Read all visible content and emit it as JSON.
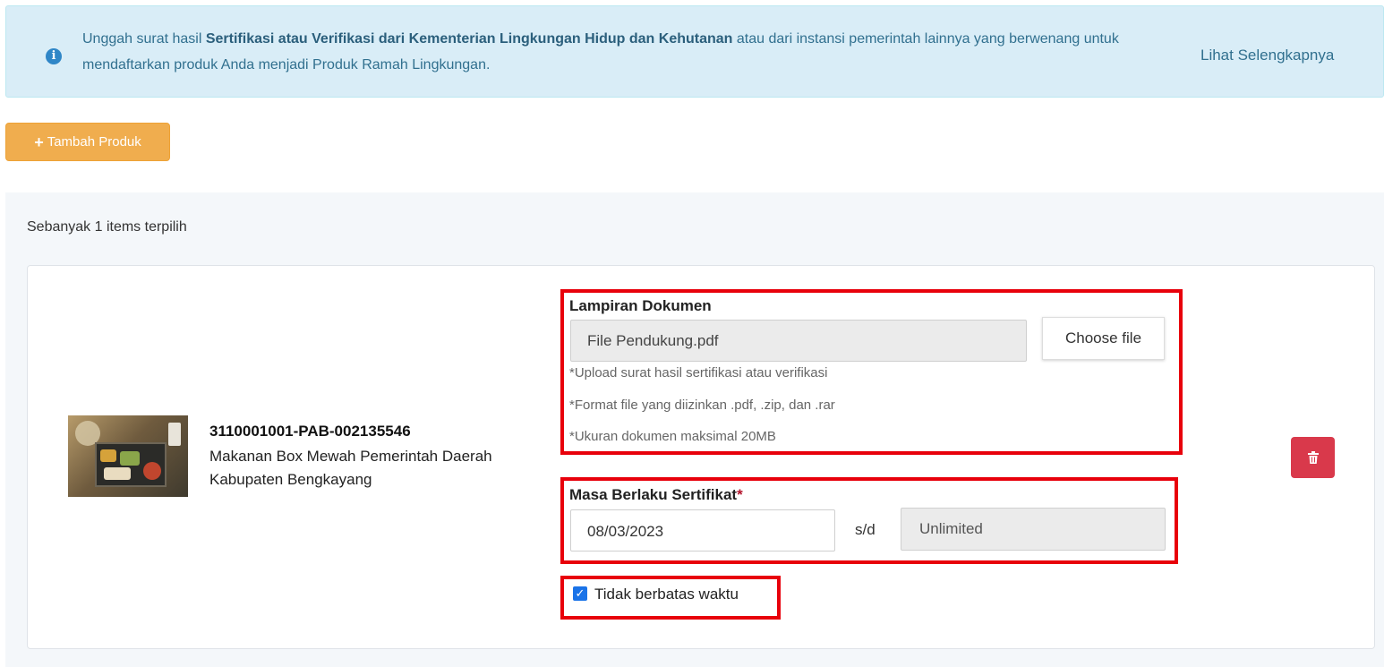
{
  "notice": {
    "text_before": "Unggah surat hasil ",
    "text_bold": "Sertifikasi atau Verifikasi dari Kementerian Lingkungan Hidup dan Kehutanan",
    "text_after": " atau dari instansi pemerintah lainnya yang berwenang untuk mendaftarkan produk Anda menjadi Produk Ramah Lingkungan.",
    "link": "Lihat Selengkapnya",
    "icon": "info-icon"
  },
  "toolbar": {
    "add_label": "Tambah Produk",
    "add_icon": "plus-icon"
  },
  "selection": {
    "count_text": "Sebanyak 1 items terpilih"
  },
  "product": {
    "code": "3110001001-PAB-002135546",
    "name": "Makanan Box Mewah Pemerintah Daerah Kabupaten Bengkayang"
  },
  "document": {
    "label": "Lampiran Dokumen",
    "file_value": "File Pendukung.pdf",
    "choose_label": "Choose file",
    "hints": [
      "*Upload surat hasil sertifikasi atau verifikasi",
      "*Format file yang diizinkan .pdf, .zip, dan .rar",
      "*Ukuran dokumen maksimal 20MB"
    ]
  },
  "validity": {
    "label": "Masa Berlaku Sertifikat",
    "required_mark": "*",
    "start_date": "08/03/2023",
    "separator": "s/d",
    "end_value": "Unlimited"
  },
  "no_expiry": {
    "label": "Tidak berbatas waktu",
    "checked": true
  },
  "colors": {
    "alert_bg": "#d9edf7",
    "add_button": "#f0ad4e",
    "delete_button": "#d9394b",
    "highlight": "#e8000b",
    "checkbox": "#1a73e8"
  }
}
